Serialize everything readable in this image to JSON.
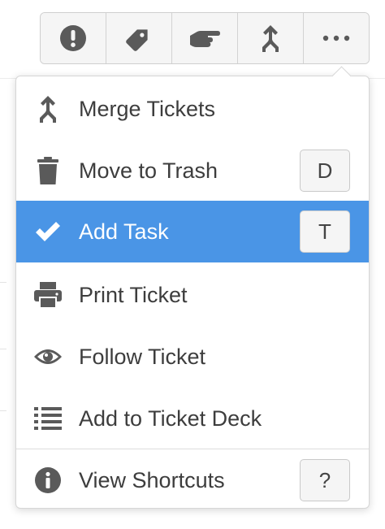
{
  "toolbar": {
    "buttons": [
      {
        "name": "priority",
        "icon": "exclamation-circle-icon"
      },
      {
        "name": "tag",
        "icon": "tag-icon"
      },
      {
        "name": "assign",
        "icon": "pointing-hand-icon"
      },
      {
        "name": "merge",
        "icon": "merge-arrow-icon"
      },
      {
        "name": "more",
        "icon": "ellipsis-icon"
      }
    ]
  },
  "menu": {
    "items": [
      {
        "label": "Merge Tickets",
        "icon": "merge-arrow-icon",
        "shortcut": ""
      },
      {
        "label": "Move to Trash",
        "icon": "trash-icon",
        "shortcut": "D"
      },
      {
        "label": "Add Task",
        "icon": "checkmark-icon",
        "shortcut": "T",
        "active": true
      },
      {
        "label": "Print Ticket",
        "icon": "printer-icon",
        "shortcut": ""
      },
      {
        "label": "Follow Ticket",
        "icon": "eye-icon",
        "shortcut": ""
      },
      {
        "label": "Add to Ticket Deck",
        "icon": "list-icon",
        "shortcut": ""
      },
      {
        "label": "View Shortcuts",
        "icon": "info-circle-icon",
        "shortcut": "?"
      }
    ]
  },
  "colors": {
    "accent": "#4a95e6",
    "icon_gray": "#5a5a5a",
    "text": "#3d3d3d"
  }
}
